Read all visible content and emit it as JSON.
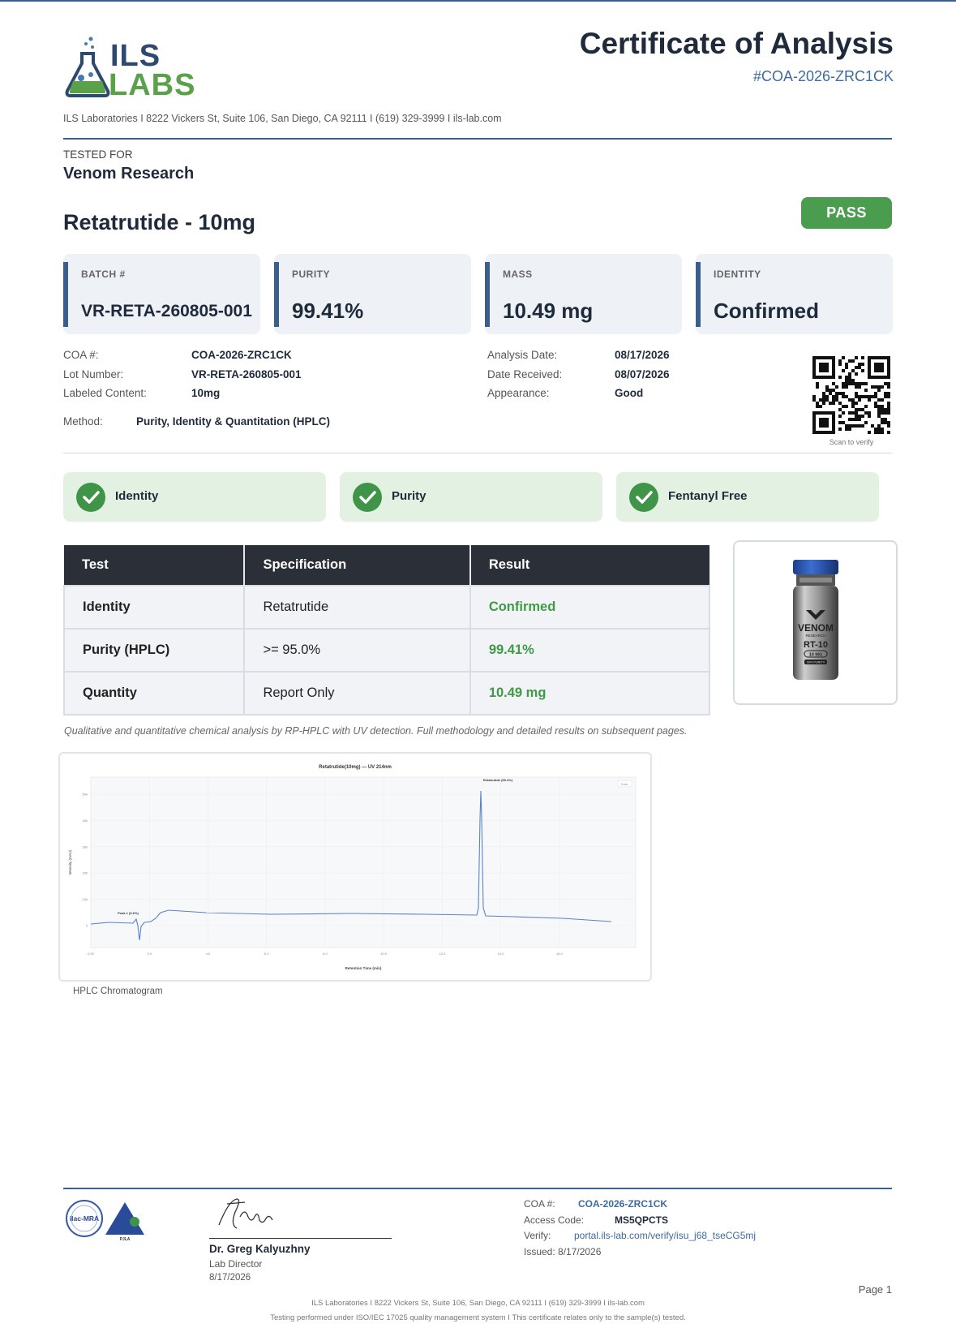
{
  "header": {
    "logo_text_top": "ILS",
    "logo_text_bottom": "LABS",
    "title": "Certificate of Analysis",
    "coa_id": "#COA-2026-ZRC1CK",
    "address": "ILS Laboratories  I  8222 Vickers St, Suite 106, San Diego, CA 92111  I  (619) 329-3999  I  ils-lab.com"
  },
  "client": {
    "label": "TESTED FOR",
    "name": "Venom Research"
  },
  "product": {
    "name": "Retatrutide - 10mg",
    "status": "PASS"
  },
  "summary_cards": [
    {
      "label": "BATCH #",
      "value": "VR-RETA-260805-001"
    },
    {
      "label": "PURITY",
      "value": "99.41%"
    },
    {
      "label": "MASS",
      "value": "10.49 mg"
    },
    {
      "label": "IDENTITY",
      "value": "Confirmed"
    }
  ],
  "details": {
    "coa_label": "COA #:",
    "coa_value": "COA-2026-ZRC1CK",
    "lot_label": "Lot Number:",
    "lot_value": "VR-RETA-260805-001",
    "content_label": "Labeled Content:",
    "content_value": "10mg",
    "method_label": "Method:",
    "method_value": "Purity, Identity & Quantitation (HPLC)",
    "analysis_label": "Analysis Date:",
    "analysis_value": "08/17/2026",
    "received_label": "Date Received:",
    "received_value": "08/07/2026",
    "appearance_label": "Appearance:",
    "appearance_value": "Good",
    "scan_text": "Scan to verify"
  },
  "checks": [
    "Identity",
    "Purity",
    "Fentanyl Free"
  ],
  "results_table": {
    "headers": [
      "Test",
      "Specification",
      "Result"
    ],
    "rows": [
      [
        "Identity",
        "Retatrutide",
        "Confirmed"
      ],
      [
        "Purity (HPLC)",
        ">= 95.0%",
        "99.41%"
      ],
      [
        "Quantity",
        "Report Only",
        "10.49 mg"
      ]
    ],
    "note": "Qualitative and quantitative chemical analysis by RP-HPLC with UV detection. Full methodology and detailed results on subsequent pages."
  },
  "vial": {
    "brand": "VENOM",
    "sub": "RESEARCH",
    "code": "RT-10",
    "dose": "10 MG",
    "purity_tag": "99% PURITY"
  },
  "chromatogram": {
    "caption": "HPLC Chromatogram",
    "title": "Retatrutide(10mg) — UV 214nm",
    "xlabel": "Retention Time (min)",
    "ylabel": "Intensity (mAU)",
    "peak1_label": "Peak 1 (0.6%)",
    "peak2_label": "Retatrutide (99.4%)",
    "legend": "Data",
    "x_ticks": [
      "0.00",
      "2.0",
      "4.0",
      "6.0",
      "8.0",
      "10.0",
      "12.0",
      "14.0",
      "16.0"
    ],
    "y_ticks": [
      "0",
      "10k",
      "20k",
      "30k",
      "40k",
      "50k"
    ]
  },
  "footer": {
    "signer": "Dr. Greg Kalyuzhny",
    "role": "Lab Director",
    "sign_date": "8/17/2026",
    "coa_label": "COA #:",
    "coa_value": "COA-2026-ZRC1CK",
    "access_label": "Access Code:",
    "access_value": "MS5QPCTS",
    "verify_label": "Verify:",
    "verify_value": "portal.ils-lab.com/verify/isu_j68_tseCG5mj",
    "issued": "Issued: 8/17/2026",
    "page": "Page 1",
    "line1": "ILS Laboratories  I  8222 Vickers St, Suite 106, San Diego, CA 92111  I  (619) 329-3999  I  ils-lab.com",
    "line2": "Testing performed under ISO/IEC 17025 quality management system  I  This certificate relates only to the sample(s) tested.",
    "accred1": "ilac-MRA",
    "accred2": "PJLA"
  },
  "colors": {
    "accent": "#3b5f8a",
    "pass": "#4a9c4f",
    "result_green": "#3f9a45",
    "logo_green": "#5aa24a"
  }
}
